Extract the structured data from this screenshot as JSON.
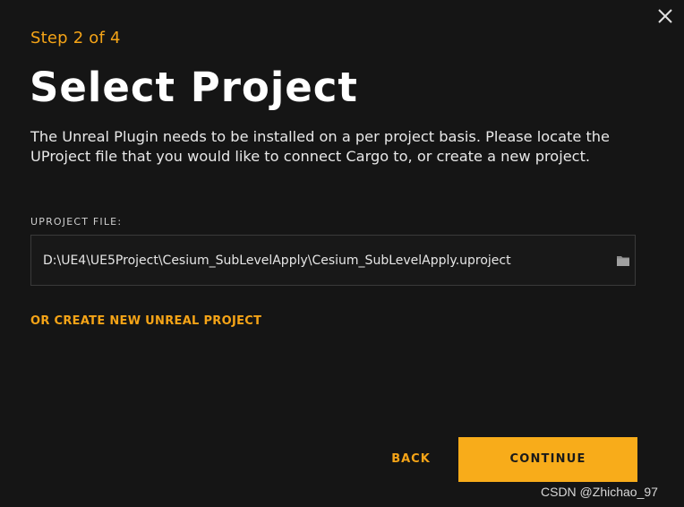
{
  "dialog": {
    "step_label": "Step 2 of 4",
    "title": "Select Project",
    "description": "The Unreal Plugin needs to be installed on a per project basis. Please locate the UProject file that you would like to connect Cargo to, or create a new project.",
    "field": {
      "label": "UPROJECT FILE:",
      "value": "D:\\UE4\\UE5Project\\Cesium_SubLevelApply\\Cesium_SubLevelApply.uproject"
    },
    "create_link": "OR CREATE NEW UNREAL PROJECT",
    "back_label": "BACK",
    "continue_label": "CONTINUE"
  },
  "watermark": "CSDN @Zhichao_97",
  "icons": {
    "close": "close-icon",
    "folder": "folder-icon"
  },
  "colors": {
    "background": "#151515",
    "accent": "#f5a417",
    "primary_button": "#f8ac1a",
    "field_border": "#3a3a3a"
  }
}
